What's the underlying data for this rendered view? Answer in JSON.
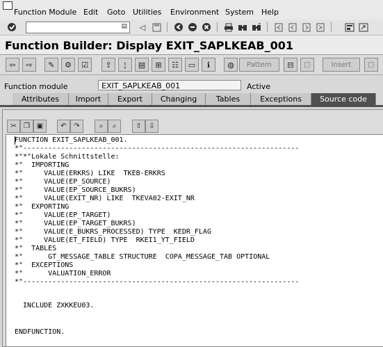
{
  "menu": [
    "Function Module",
    "Edit",
    "Goto",
    "Utilities",
    "Environment",
    "System",
    "Help"
  ],
  "toolbar": {
    "command_value": "",
    "icons": [
      "enter-icon",
      "command-dropdown-icon",
      "back-icon",
      "save-icon",
      "back-nav-icon",
      "exit-icon",
      "cancel-icon",
      "print-icon",
      "find-icon",
      "find-next-icon",
      "first-page-icon",
      "previous-page-icon",
      "next-page-icon",
      "last-page-icon",
      "new-session-icon",
      "shortcut-icon"
    ]
  },
  "title": "Function Builder: Display EXIT_SAPLKEAB_001",
  "app_toolbar": {
    "pattern_label": "Pattern",
    "insert_label": "Insert"
  },
  "function_module": {
    "label": "Function module",
    "value": "EXIT_SAPLKEAB_001",
    "status": "Active"
  },
  "tabs": [
    "Attributes",
    "Import",
    "Export",
    "Changing",
    "Tables",
    "Exceptions",
    "Source code"
  ],
  "active_tab": "Source code",
  "code_lines": [
    "FUNCTION EXIT_SAPLKEAB_001.",
    "*\"------------------------------------------------------------------",
    "*\"*\"Lokale Schnittstelle:",
    "*\"  IMPORTING",
    "*\"     VALUE(ERKRS) LIKE  TKEB-ERKRS",
    "*\"     VALUE(EP_SOURCE)",
    "*\"     VALUE(EP_SOURCE_BUKRS)",
    "*\"     VALUE(EXIT_NR) LIKE  TKEVA02-EXIT_NR",
    "*\"  EXPORTING",
    "*\"     VALUE(EP_TARGET)",
    "*\"     VALUE(EP_TARGET_BUKRS)",
    "*\"     VALUE(E_BUKRS_PROCESSED) TYPE  KEDR_FLAG",
    "*\"     VALUE(ET_FIELD) TYPE  RKEI1_YT_FIELD",
    "*\"  TABLES",
    "*\"      GT_MESSAGE_TABLE STRUCTURE  COPA_MESSAGE_TAB OPTIONAL",
    "*\"  EXCEPTIONS",
    "*\"      VALUATION_ERROR",
    "*\"------------------------------------------------------------------",
    "",
    "",
    "  INCLUDE ZXKKEU03.",
    "",
    "",
    "ENDFUNCTION."
  ]
}
